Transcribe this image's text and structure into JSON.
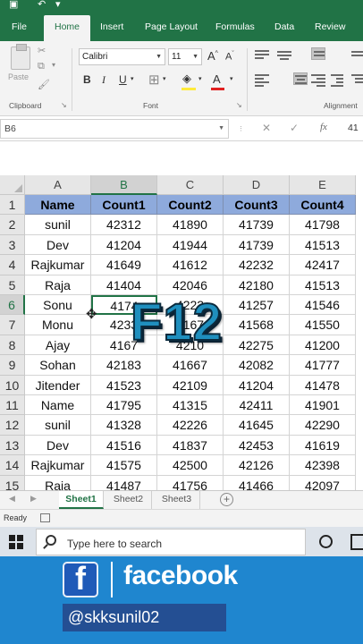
{
  "ribbon": {
    "tabs": [
      {
        "label": "File",
        "active": false
      },
      {
        "label": "Home",
        "active": true
      },
      {
        "label": "Insert",
        "active": false
      },
      {
        "label": "Page Layout",
        "active": false
      },
      {
        "label": "Formulas",
        "active": false
      },
      {
        "label": "Data",
        "active": false
      },
      {
        "label": "Review",
        "active": false
      }
    ],
    "paste_label": "Paste",
    "clipboard_label": "Clipboard",
    "font_group_label": "Font",
    "alignment_group_label": "Alignment",
    "font_name": "Calibri",
    "font_size": "11",
    "grow_label": "A",
    "shrink_label": "A",
    "bold_label": "B",
    "italic_label": "I",
    "underline_label": "U",
    "font_color_label": "A",
    "fill_color": "#ffeb3b",
    "font_color": "#e02020"
  },
  "formula_bar": {
    "name_box": "B6",
    "fx_label": "fx",
    "value": "41"
  },
  "grid": {
    "columns": [
      "A",
      "B",
      "C",
      "D",
      "E"
    ],
    "selected_column": "B",
    "selected_row": "6",
    "rows": [
      {
        "num": "1",
        "cells": [
          "Name",
          "Count1",
          "Count2",
          "Count3",
          "Count4"
        ]
      },
      {
        "num": "2",
        "cells": [
          "sunil",
          "42312",
          "41890",
          "41739",
          "41798"
        ]
      },
      {
        "num": "3",
        "cells": [
          "Dev",
          "41204",
          "41944",
          "41739",
          "41513"
        ]
      },
      {
        "num": "4",
        "cells": [
          "Rajkumar",
          "41649",
          "41612",
          "42232",
          "42417"
        ]
      },
      {
        "num": "5",
        "cells": [
          "Raja",
          "41404",
          "42046",
          "42180",
          "41513"
        ]
      },
      {
        "num": "6",
        "cells": [
          "Sonu",
          "4174",
          "4222",
          "41257",
          "41546"
        ]
      },
      {
        "num": "7",
        "cells": [
          "Monu",
          "4233",
          "4167",
          "41568",
          "41550"
        ]
      },
      {
        "num": "8",
        "cells": [
          "Ajay",
          "4167",
          "4210",
          "42275",
          "41200"
        ]
      },
      {
        "num": "9",
        "cells": [
          "Sohan",
          "42183",
          "41667",
          "42082",
          "41777"
        ]
      },
      {
        "num": "10",
        "cells": [
          "Jitender",
          "41523",
          "42109",
          "41204",
          "41478"
        ]
      },
      {
        "num": "11",
        "cells": [
          "Name",
          "41795",
          "41315",
          "42411",
          "41901"
        ]
      },
      {
        "num": "12",
        "cells": [
          "sunil",
          "41328",
          "42226",
          "41645",
          "42290"
        ]
      },
      {
        "num": "13",
        "cells": [
          "Dev",
          "41516",
          "41837",
          "42453",
          "41619"
        ]
      },
      {
        "num": "14",
        "cells": [
          "Rajkumar",
          "41575",
          "42500",
          "42126",
          "42398"
        ]
      },
      {
        "num": "15",
        "cells": [
          "Raja",
          "41487",
          "41756",
          "41466",
          "42097"
        ]
      }
    ],
    "header_fill": "#8eaadc",
    "overlay_text": "F12"
  },
  "sheets": {
    "tabs": [
      {
        "label": "Sheet1",
        "active": true
      },
      {
        "label": "Sheet2",
        "active": false
      },
      {
        "label": "Sheet3",
        "active": false
      }
    ],
    "add_label": "+"
  },
  "status_bar": {
    "text": "Ready"
  },
  "taskbar": {
    "search_placeholder": "Type here to search"
  },
  "social": {
    "network": "facebook",
    "icon_letter": "f",
    "handle": "@skksunil02"
  }
}
